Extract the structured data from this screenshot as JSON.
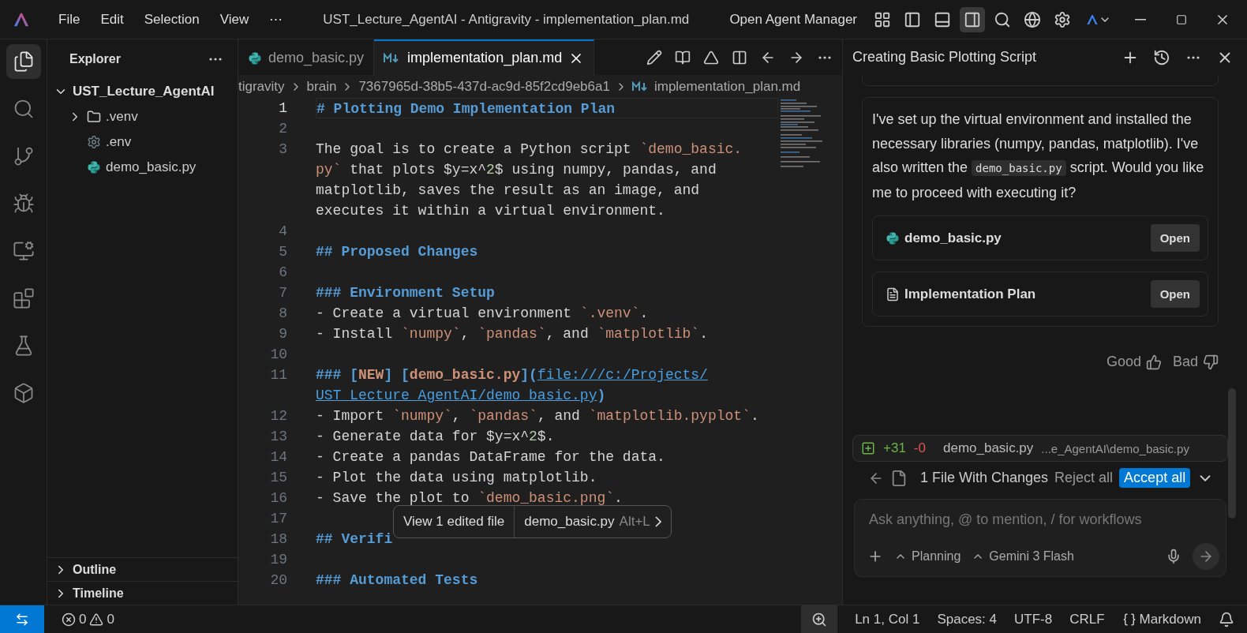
{
  "title_bar": {
    "menu": [
      "File",
      "Edit",
      "Selection",
      "View",
      "⋯"
    ],
    "title": "UST_Lecture_AgentAI - Antigravity - implementation_plan.md",
    "agent_manager": "Open Agent Manager",
    "layout_toggles": [
      {
        "selected": false
      },
      {
        "selected": false
      },
      {
        "selected": true
      }
    ]
  },
  "activity_bar": [
    {
      "kind": "explorer",
      "selected": true
    },
    {
      "kind": "search",
      "selected": false
    },
    {
      "kind": "branch",
      "selected": false
    },
    {
      "kind": "debug",
      "selected": false
    },
    {
      "kind": "remote",
      "selected": false
    },
    {
      "kind": "extensions",
      "selected": false
    },
    {
      "kind": "flask",
      "selected": false
    },
    {
      "kind": "box",
      "selected": false
    }
  ],
  "sidebar": {
    "title": "Explorer",
    "tree": [
      {
        "label": "UST_Lecture_AgentAI",
        "kind": "folder",
        "expanded": true,
        "children": [
          {
            "label": ".venv",
            "kind": "folder",
            "expanded": false
          },
          {
            "label": ".env",
            "kind": "settings"
          },
          {
            "label": "demo_basic.py",
            "kind": "python"
          }
        ]
      }
    ],
    "sections": [
      {
        "label": "Outline",
        "expanded": false
      },
      {
        "label": "Timeline",
        "expanded": false
      }
    ]
  },
  "tabs": [
    {
      "label": "demo_basic.py",
      "kind": "python",
      "selected": false
    },
    {
      "label": "implementation_plan.md",
      "kind": "markdown",
      "selected": true
    }
  ],
  "breadcrumb": [
    "tigravity",
    "brain",
    "7367965d-38b5-437d-ac9d-85f2cd9eb6a1",
    "implementation_plan.md"
  ],
  "editor": {
    "lines": [
      {
        "number": "1",
        "current": true,
        "rows": [
          {
            "segments": [
              {
                "kind": "h",
                "text": "# Plotting Demo Implementation Plan"
              }
            ]
          }
        ]
      },
      {
        "number": "2",
        "current": false
      },
      {
        "number": "3",
        "current": false,
        "rows": [
          {
            "segments": [
              {
                "kind": "t",
                "text": "The goal is to create a Python script "
              },
              {
                "kind": "c",
                "text": "`demo_basic."
              }
            ]
          },
          {
            "segments": [
              {
                "kind": "c",
                "text": "py`"
              },
              {
                "kind": "t",
                "text": " that plots $y=x^"
              },
              {
                "kind": "n",
                "text": "2"
              },
              {
                "kind": "t",
                "text": "$ using numpy, pandas, and"
              }
            ]
          },
          {
            "segments": [
              {
                "kind": "t",
                "text": "matplotlib, saves the result as an image, and"
              }
            ]
          },
          {
            "segments": [
              {
                "kind": "t",
                "text": "executes it within a virtual environment."
              }
            ]
          }
        ]
      },
      {
        "number": "4",
        "current": false
      },
      {
        "number": "5",
        "current": false,
        "rows": [
          {
            "segments": [
              {
                "kind": "h",
                "text": "## Proposed Changes"
              }
            ]
          }
        ]
      },
      {
        "number": "6",
        "current": false
      },
      {
        "number": "7",
        "current": false,
        "rows": [
          {
            "segments": [
              {
                "kind": "h",
                "text": "### Environment Setup"
              }
            ]
          }
        ]
      },
      {
        "number": "8",
        "current": false,
        "rows": [
          {
            "segments": [
              {
                "kind": "t",
                "text": "- Create a virtual environment "
              },
              {
                "kind": "c",
                "text": "`.venv`"
              },
              {
                "kind": "t",
                "text": "."
              }
            ]
          }
        ]
      },
      {
        "number": "9",
        "current": false,
        "rows": [
          {
            "segments": [
              {
                "kind": "t",
                "text": "- Install "
              },
              {
                "kind": "c",
                "text": "`numpy`"
              },
              {
                "kind": "t",
                "text": ", "
              },
              {
                "kind": "c",
                "text": "`pandas`"
              },
              {
                "kind": "t",
                "text": ", and "
              },
              {
                "kind": "c",
                "text": "`matplotlib`"
              },
              {
                "kind": "t",
                "text": "."
              }
            ]
          }
        ]
      },
      {
        "number": "10",
        "current": false
      },
      {
        "number": "11",
        "current": false,
        "rows": [
          {
            "segments": [
              {
                "kind": "h",
                "text": "### ["
              },
              {
                "kind": "b",
                "text": "NEW"
              },
              {
                "kind": "h",
                "text": "] ["
              },
              {
                "kind": "b",
                "text": "demo_basic.py"
              },
              {
                "kind": "h",
                "text": "]("
              },
              {
                "kind": "l",
                "text": "file:///c:/Projects/"
              }
            ]
          },
          {
            "segments": [
              {
                "kind": "l",
                "text": "UST_Lecture_AgentAI/demo_basic.py"
              },
              {
                "kind": "h",
                "text": ")"
              }
            ]
          }
        ]
      },
      {
        "number": "12",
        "current": false,
        "rows": [
          {
            "segments": [
              {
                "kind": "t",
                "text": "- Import "
              },
              {
                "kind": "c",
                "text": "`numpy`"
              },
              {
                "kind": "t",
                "text": ", "
              },
              {
                "kind": "c",
                "text": "`pandas`"
              },
              {
                "kind": "t",
                "text": ", and "
              },
              {
                "kind": "c",
                "text": "`matplotlib.pyplot`"
              },
              {
                "kind": "t",
                "text": "."
              }
            ]
          }
        ]
      },
      {
        "number": "13",
        "current": false,
        "rows": [
          {
            "segments": [
              {
                "kind": "t",
                "text": "- Generate data for $y=x^"
              },
              {
                "kind": "n",
                "text": "2"
              },
              {
                "kind": "t",
                "text": "$."
              }
            ]
          }
        ]
      },
      {
        "number": "14",
        "current": false,
        "rows": [
          {
            "segments": [
              {
                "kind": "t",
                "text": "- Create a pandas DataFrame for the data."
              }
            ]
          }
        ]
      },
      {
        "number": "15",
        "current": false,
        "rows": [
          {
            "segments": [
              {
                "kind": "t",
                "text": "- Plot the data using matplotlib."
              }
            ]
          }
        ]
      },
      {
        "number": "16",
        "current": false,
        "rows": [
          {
            "segments": [
              {
                "kind": "t",
                "text": "- Save the plot to "
              },
              {
                "kind": "c",
                "text": "`demo_basic.png`"
              },
              {
                "kind": "t",
                "text": "."
              }
            ]
          }
        ]
      },
      {
        "number": "17",
        "current": false
      },
      {
        "number": "18",
        "current": false,
        "rows": [
          {
            "segments": [
              {
                "kind": "h",
                "text": "## Verifi"
              }
            ]
          }
        ]
      },
      {
        "number": "19",
        "current": false
      },
      {
        "number": "20",
        "current": false,
        "rows": [
          {
            "segments": [
              {
                "kind": "h",
                "text": "### Automated Tests"
              }
            ]
          }
        ]
      }
    ],
    "popup": {
      "label": "View 1 edited file",
      "file": "demo_basic.py",
      "shortcut": "Alt+L"
    }
  },
  "chat": {
    "title": "Creating Basic Plotting Script",
    "message": [
      {
        "kind": "text",
        "text": "I've set up the virtual environment and installed the necessary libraries (numpy, pandas, matplotlib). I've also written the "
      },
      {
        "kind": "code",
        "text": "demo_basic.py"
      },
      {
        "kind": "text",
        "text": " script. Would you like me to proceed with executing it?"
      }
    ],
    "attachments": [
      {
        "kind": "python",
        "label": "demo_basic.py",
        "action": "Open"
      },
      {
        "kind": "document",
        "label": "Implementation Plan",
        "action": "Open"
      }
    ],
    "feedback": [
      {
        "kind": "up",
        "label": "Good"
      },
      {
        "kind": "down",
        "label": "Bad"
      }
    ],
    "changes": {
      "added": "+31",
      "removed": "-0",
      "file": "demo_basic.py",
      "path": "...e_AgentAI\\demo_basic.py"
    },
    "summary": "1 File With Changes",
    "reject": "Reject all",
    "accept": "Accept all",
    "input": {
      "placeholder": "Ask anything, @ to mention, / for workflows",
      "mode": "Planning",
      "model": "Gemini 3 Flash"
    }
  },
  "status_bar": {
    "errors": "0",
    "warnings": "0",
    "items": [
      "Ln 1, Col 1",
      "Spaces: 4",
      "UTF-8",
      "CRLF"
    ],
    "language": "Markdown"
  }
}
